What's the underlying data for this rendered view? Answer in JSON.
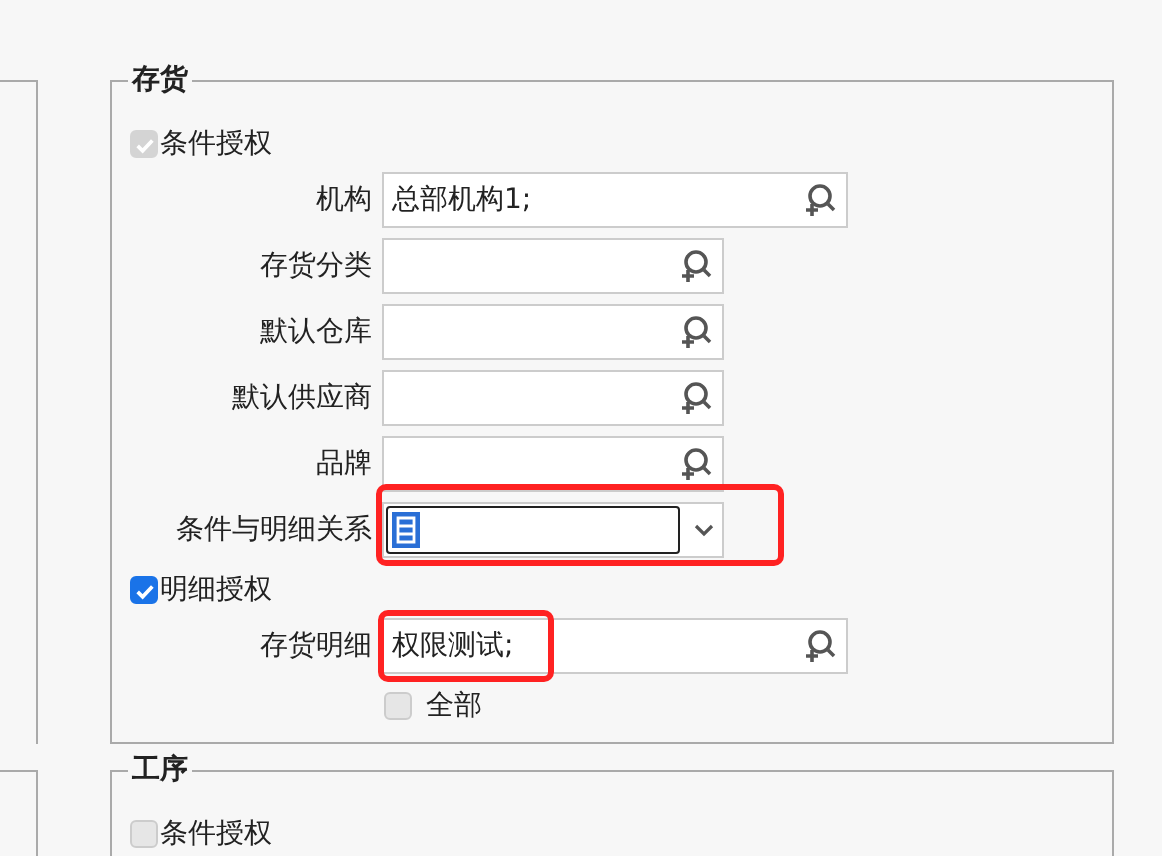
{
  "groups": [
    {
      "title": "存货",
      "rows": [
        {
          "kind": "checkbox",
          "label": "条件授权",
          "checked": true,
          "disabled": true
        },
        {
          "kind": "lookup",
          "label": "机构",
          "value": "总部机构1;",
          "wide": true,
          "highlighted": false
        },
        {
          "kind": "lookup",
          "label": "存货分类",
          "wide": false,
          "highlighted": false
        },
        {
          "kind": "lookup",
          "label": "默认仓库",
          "wide": false,
          "highlighted": false
        },
        {
          "kind": "lookup",
          "label": "默认供应商",
          "wide": false,
          "highlighted": false
        },
        {
          "kind": "lookup",
          "label": "品牌",
          "wide": false,
          "highlighted": false
        },
        {
          "kind": "combo",
          "label": "条件与明细关系",
          "focused": true,
          "highlighted": true
        },
        {
          "kind": "checkbox",
          "label": "明细授权",
          "checked": true,
          "disabled": false
        },
        {
          "kind": "lookup",
          "label": "存货明细",
          "value": "权限测试;",
          "wide": true,
          "highlighted": true
        },
        {
          "kind": "option",
          "label": "全部",
          "checked": false,
          "disabled": true
        }
      ]
    },
    {
      "title": "工序",
      "rows": [
        {
          "kind": "checkbox",
          "label": "条件授权",
          "checked": false,
          "disabled": true
        }
      ]
    }
  ]
}
